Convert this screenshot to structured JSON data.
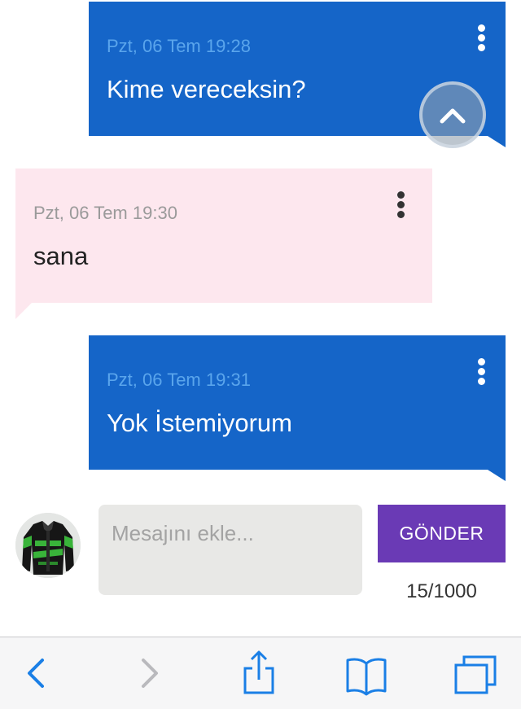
{
  "messages": [
    {
      "timestamp": "Pzt, 06 Tem 19:28",
      "text": "Kime vereceksin?"
    },
    {
      "timestamp": "Pzt, 06 Tem 19:30",
      "text": "sana"
    },
    {
      "timestamp": "Pzt, 06 Tem 19:31",
      "text": "Yok İstemiyorum"
    }
  ],
  "composer": {
    "placeholder": "Mesajını ekle...",
    "send_label": "GÖNDER",
    "counter": "15/1000"
  },
  "toolbar": {
    "icons": [
      "back-icon",
      "forward-icon",
      "share-icon",
      "bookmarks-icon",
      "tabs-icon"
    ]
  },
  "colors": {
    "sent_bubble": "#1565c8",
    "received_bubble": "#fde7ee",
    "send_button": "#6a3ab5",
    "toolbar_accent": "#1a7fe6"
  }
}
